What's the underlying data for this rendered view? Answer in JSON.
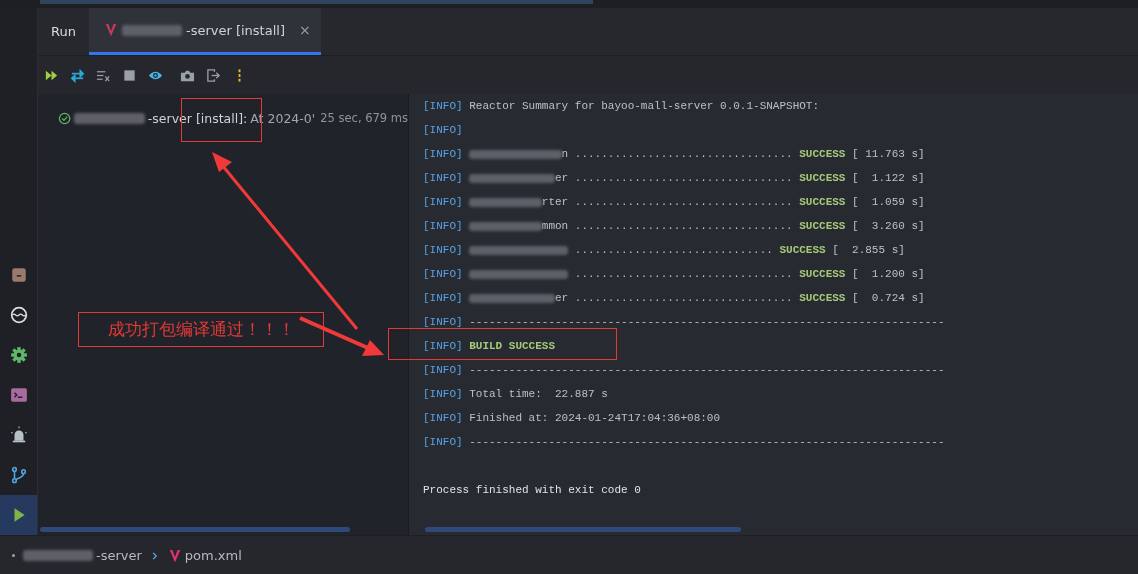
{
  "tool_strip": {
    "items": [
      {
        "kind": "archive",
        "selected": false
      },
      {
        "kind": "wave",
        "selected": false
      },
      {
        "kind": "gear",
        "selected": false
      },
      {
        "kind": "terminal",
        "selected": false
      },
      {
        "kind": "alarm",
        "selected": false
      },
      {
        "kind": "branch",
        "selected": false
      },
      {
        "kind": "run",
        "selected": true
      }
    ]
  },
  "tool_window_title": "Run",
  "tabs": [
    {
      "label": "-server [install]",
      "selected": true,
      "redacted": true,
      "close": "×"
    }
  ],
  "toolbar": {
    "buttons": [
      {
        "kind": "rerun"
      },
      {
        "kind": "toggle"
      },
      {
        "kind": "clear"
      },
      {
        "kind": "stop"
      },
      {
        "kind": "eye"
      },
      {
        "kind": "camera"
      },
      {
        "kind": "exit"
      },
      {
        "kind": "more"
      }
    ]
  },
  "run_tree": {
    "items": [
      {
        "passed": true,
        "label": "-server [install]:",
        "detail": "At 2024-0'",
        "duration": "25 sec, 679 ms",
        "redacted": true
      }
    ]
  },
  "console": {
    "lines": [
      {
        "kind": "info",
        "level": "[INFO]",
        "text": "Reactor Summary for bayoo-mall-server 0.0.1-SNAPSHOT:"
      },
      {
        "kind": "info",
        "level": "[INFO]"
      },
      {
        "kind": "module",
        "level": "[INFO]",
        "tail": "n",
        "dots": ".................................",
        "result": "SUCCESS",
        "time": "[ 11.763 s]"
      },
      {
        "kind": "module",
        "level": "[INFO]",
        "tail": "er",
        "dots": ".................................",
        "result": "SUCCESS",
        "time": "[  1.122 s]"
      },
      {
        "kind": "module",
        "level": "[INFO]",
        "tail": "rter",
        "dots": ".................................",
        "result": "SUCCESS",
        "time": "[  1.059 s]"
      },
      {
        "kind": "module",
        "level": "[INFO]",
        "tail": "mmon",
        "dots": ".................................",
        "result": "SUCCESS",
        "time": "[  3.260 s]"
      },
      {
        "kind": "module",
        "level": "[INFO]",
        "dots": "..............................",
        "result": "SUCCESS",
        "time": "[  2.855 s]"
      },
      {
        "kind": "module",
        "level": "[INFO]",
        "dots": ".................................",
        "result": "SUCCESS",
        "time": "[  1.200 s]"
      },
      {
        "kind": "module",
        "level": "[INFO]",
        "tail": "er",
        "dots": ".................................",
        "result": "SUCCESS",
        "time": "[  0.724 s]"
      },
      {
        "kind": "info",
        "level": "[INFO]",
        "text": "------------------------------------------------------------------------"
      },
      {
        "kind": "success",
        "level": "[INFO]",
        "text": "BUILD SUCCESS"
      },
      {
        "kind": "info",
        "level": "[INFO]",
        "text": "------------------------------------------------------------------------"
      },
      {
        "kind": "info",
        "level": "[INFO]",
        "text": "Total time:  22.887 s"
      },
      {
        "kind": "info",
        "level": "[INFO]",
        "text": "Finished at: 2024-01-24T17:04:36+08:00"
      },
      {
        "kind": "info",
        "level": "[INFO]",
        "text": "------------------------------------------------------------------------"
      },
      {
        "kind": "blank"
      },
      {
        "kind": "process",
        "text": "Process finished with exit code 0"
      }
    ]
  },
  "annotation": {
    "note": "成功打包编译通过！！！"
  },
  "breadcrumbs": [
    {
      "label": "-server",
      "kind": "module",
      "redacted": true
    },
    {
      "label": "pom.xml",
      "kind": "maven",
      "redacted": false
    }
  ]
}
